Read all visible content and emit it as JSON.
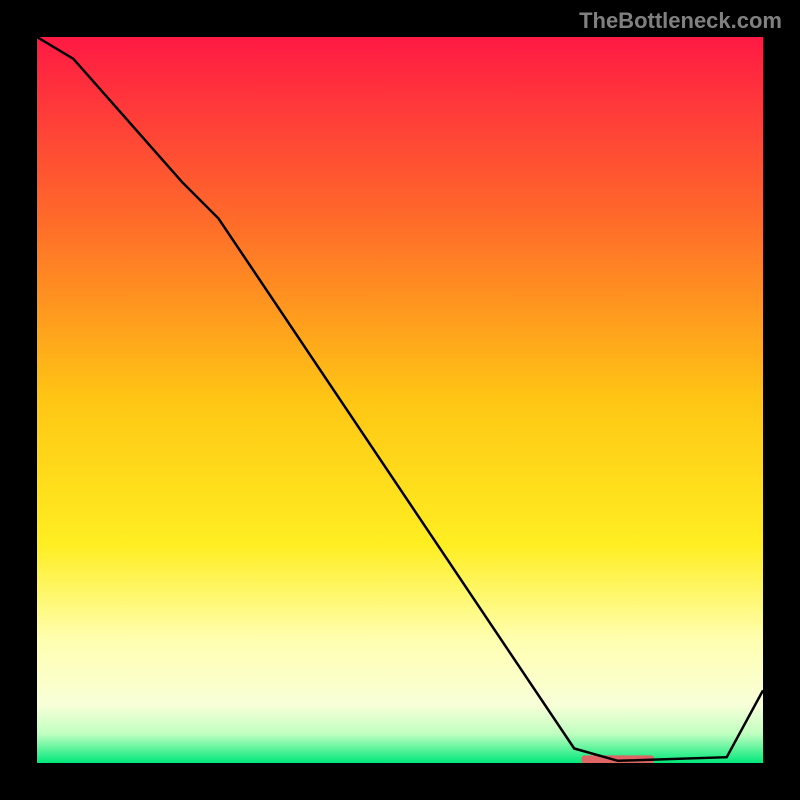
{
  "watermark": "TheBottleneck.com",
  "chart_data": {
    "type": "line",
    "title": "",
    "xlabel": "",
    "ylabel": "",
    "xlim": [
      0,
      100
    ],
    "ylim": [
      0,
      100
    ],
    "background_gradient": {
      "stops": [
        {
          "offset": 0,
          "color": "#ff1a44"
        },
        {
          "offset": 25,
          "color": "#ff6a2a"
        },
        {
          "offset": 50,
          "color": "#ffc614"
        },
        {
          "offset": 70,
          "color": "#ffee22"
        },
        {
          "offset": 83,
          "color": "#ffffb0"
        },
        {
          "offset": 92,
          "color": "#f8ffd8"
        },
        {
          "offset": 96,
          "color": "#c0ffc0"
        },
        {
          "offset": 100,
          "color": "#00e87a"
        }
      ]
    },
    "series": [
      {
        "name": "bottleneck-curve",
        "color": "#000000",
        "width": 2.5,
        "x": [
          0,
          5,
          20,
          25,
          74,
          80,
          95,
          100
        ],
        "y": [
          100,
          97,
          80,
          75,
          2,
          0.3,
          0.8,
          10
        ]
      }
    ],
    "marker": {
      "name": "optimal-range",
      "x_start": 75,
      "x_end": 85,
      "y": 0.5,
      "color": "#e06666"
    }
  }
}
